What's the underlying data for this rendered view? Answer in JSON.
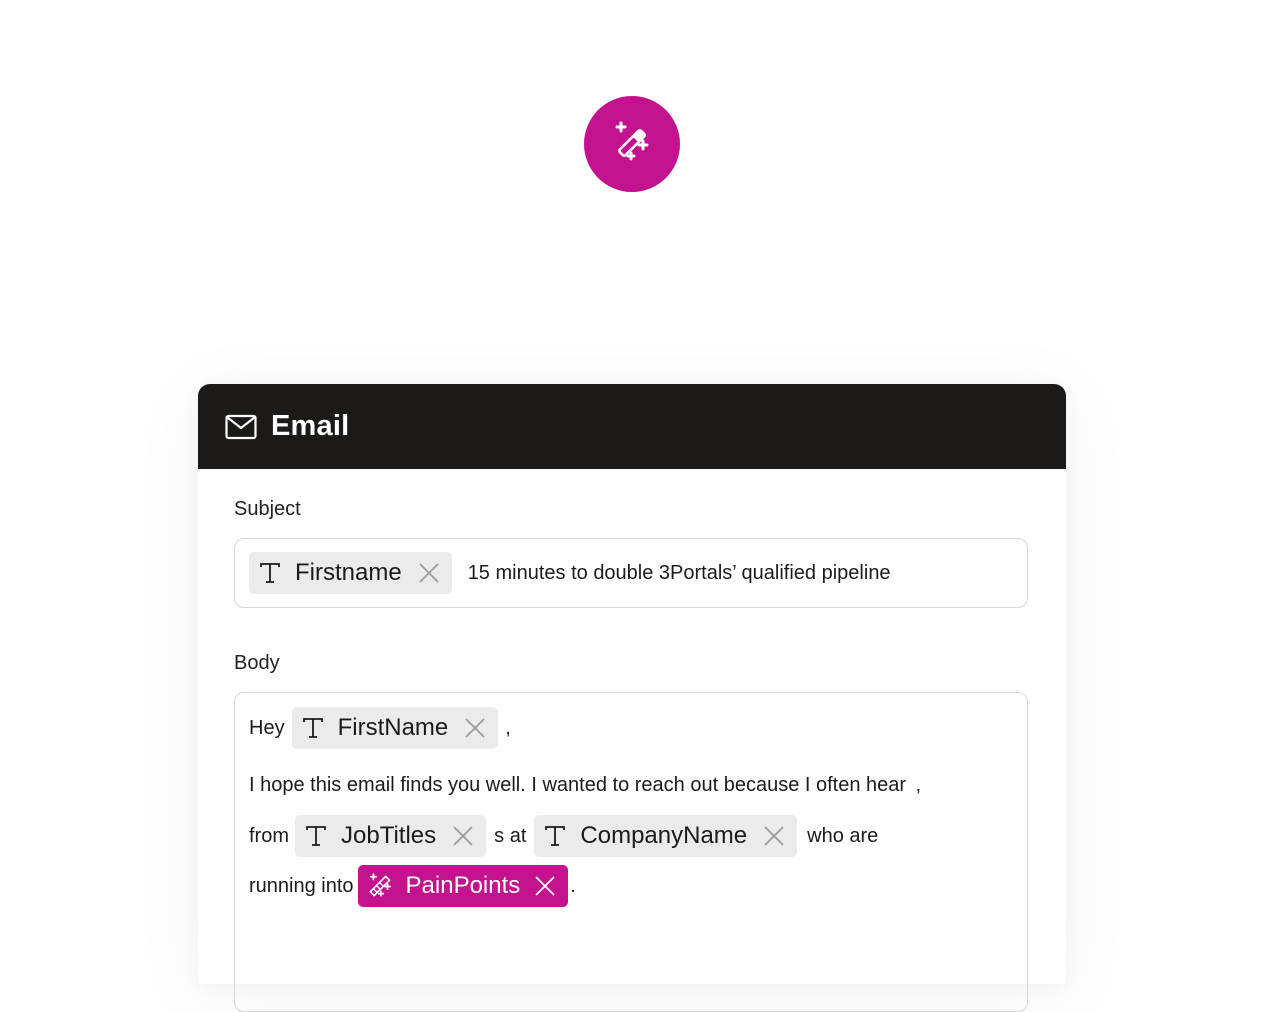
{
  "colors": {
    "accent": "#c4118e",
    "header_bg": "#1b1a18",
    "chip_bg": "#ebebeb"
  },
  "node": {
    "icon": "magic-wand-icon"
  },
  "card": {
    "title": "Email",
    "icon": "mail-icon"
  },
  "subject": {
    "label": "Subject",
    "chip": {
      "label": "Firstname",
      "icon": "text-type-icon"
    },
    "text": "15 minutes to double 3Portals’ qualified pipeline"
  },
  "body": {
    "label": "Body",
    "line1": {
      "prefix": "Hey",
      "chip": {
        "label": "FirstName",
        "icon": "text-type-icon"
      },
      "suffix": ","
    },
    "line2": {
      "text": "I hope this email finds you well. I wanted to reach out because I often hear",
      "mark": "‚"
    },
    "line3": {
      "prefix": "from",
      "chip1": {
        "label": "JobTitles",
        "icon": "text-type-icon"
      },
      "middle": "s at",
      "chip2": {
        "label": "CompanyName",
        "icon": "text-type-icon"
      },
      "suffix": "who are"
    },
    "line4": {
      "prefix": "running into",
      "chip": {
        "label": "PainPoints",
        "icon": "magic-wand-icon"
      },
      "suffix": "."
    }
  }
}
